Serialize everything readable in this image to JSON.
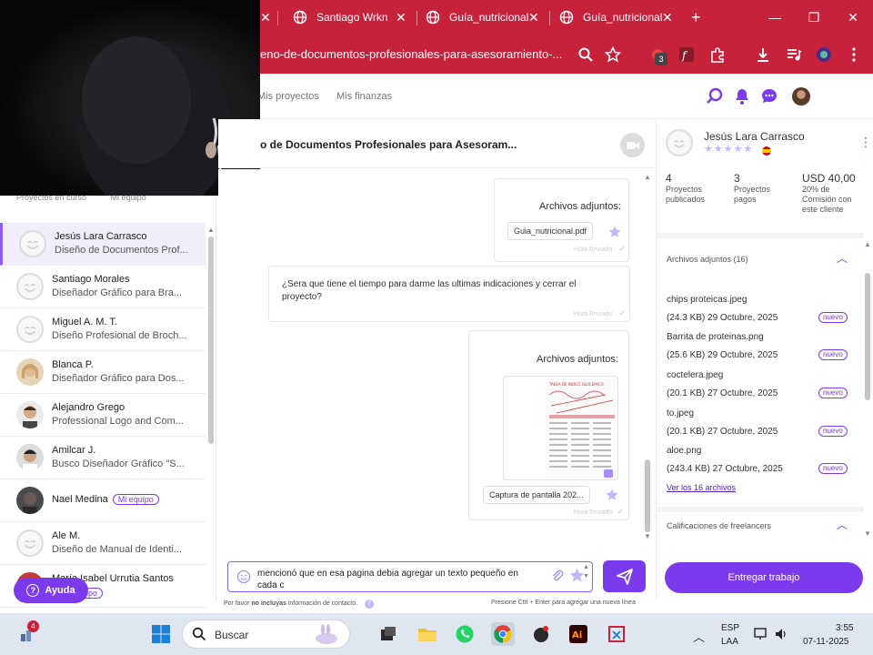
{
  "browser": {
    "tabs": [
      {
        "label": "Santiago Wrkn"
      },
      {
        "label": "Guía_nutricional"
      },
      {
        "label": "Guía_nutricional"
      }
    ],
    "new_tab_symbol": "+",
    "url": "eno-de-documentos-profesionales-para-asesoramiento-...",
    "extension_badge": "3"
  },
  "header": {
    "nav": [
      "Mis proyectos",
      "Mis finanzas"
    ]
  },
  "sidebar": {
    "sub_tabs": [
      "Proyectos en curso",
      "Mi equipo"
    ],
    "conversations": [
      {
        "name": "Jesús Lara Carrasco",
        "sub": "Diseño de Documentos Prof...",
        "active": true,
        "avatar": "default"
      },
      {
        "name": "Santiago Morales",
        "sub": "Diseñador Gráfico para Bra...",
        "avatar": "default"
      },
      {
        "name": "Miguel A. M. T.",
        "sub": "Diseño Profesional de Broch...",
        "avatar": "default"
      },
      {
        "name": "Blanca P.",
        "sub": "Diseñador Gráfico para Dos...",
        "avatar": "photo-blonde"
      },
      {
        "name": "Alejandro Grego",
        "sub": "Professional Logo and Com...",
        "avatar": "photo-man"
      },
      {
        "name": "Amilcar J.",
        "sub": "Busco Diseñador Gráfico \"S...",
        "avatar": "photo-young"
      },
      {
        "name": "Nael Medina",
        "sub": "",
        "team_chip": "Mi equipo",
        "avatar": "photo-dark"
      },
      {
        "name": "Ale M.",
        "sub": "Diseño de Manual de Identi...",
        "avatar": "default"
      },
      {
        "name": "María Isabel Urrutia Santos",
        "sub": "",
        "team_chip": "Mi equipo",
        "avatar": "photo-red"
      }
    ],
    "help_label": "Ayuda"
  },
  "chat": {
    "title": "o de Documentos Profesionales para Asesoram...",
    "messages": [
      {
        "type": "attachment",
        "title": "Archivos adjuntos:",
        "file": "Guia_nutricional.pdf",
        "time": "Hora Enviado"
      },
      {
        "type": "text",
        "text": "¿Sera que tiene el tiempo para darme las ultimas indicaciones y cerrar el proyecto?",
        "time": "Hora Enviado"
      },
      {
        "type": "attachment-image",
        "title": "Archivos adjuntos:",
        "file": "Captura de pantalla 202...",
        "time": "Hora Enviado",
        "thumb_heading": "TABLA DE INDICE GLUCEMICO"
      }
    ],
    "composer_text": "mencionó que en esa pagina debia agregar un texto pequeño en cada c",
    "hint_left_pre": "Por favor ",
    "hint_left_bold": "no incluyas",
    "hint_left_post": " información de contacto.",
    "hint_right": "Presione Ctrl + Enter para agregar una nueva línea"
  },
  "client": {
    "name": "Jesús Lara Carrasco",
    "stars": "★★★★★",
    "stats": [
      {
        "value": "4",
        "label": "Proyectos publicados"
      },
      {
        "value": "3",
        "label": "Proyectos pagos"
      },
      {
        "value": "USD 40,00",
        "label": "20% de Comisión con este cliente"
      }
    ],
    "attachments_title": "Archivos adjuntos (16)",
    "attachments": [
      {
        "name": "chips proteicas.jpeg",
        "meta": "(24.3 KB) 29 Octubre, 2025",
        "badge": "nuevo"
      },
      {
        "name": "Barrita de proteinas.png",
        "meta": "(25.6 KB) 29 Octubre, 2025",
        "badge": "nuevo"
      },
      {
        "name": "coctelera.jpeg",
        "meta": "(20.1 KB) 27 Octubre, 2025",
        "badge": "nuevo"
      },
      {
        "name": "to.jpeg",
        "meta": "(20.1 KB) 27 Octubre, 2025",
        "badge": "nuevo"
      },
      {
        "name": "aloe.png",
        "meta": "(243.4 KB) 27 Octubre, 2025",
        "badge": "nuevo"
      }
    ],
    "see_all": "Ver los 16 archivos",
    "ratings_title": "Calificaciones de freelancers",
    "deliver_button": "Entregar trabajo"
  },
  "taskbar": {
    "search_placeholder": "Buscar",
    "notif_count": "4",
    "lang_top": "ESP",
    "lang_bottom": "LAA",
    "time": "3:55",
    "date": "07-11-2025"
  },
  "colors": {
    "browser_red": "#c6223c",
    "accent_purple": "#7c3aed",
    "star_lavender": "#c4b5fd"
  }
}
